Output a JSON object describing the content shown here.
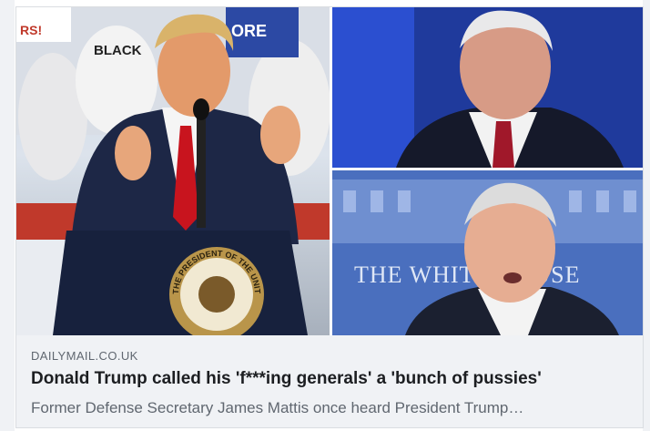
{
  "link_preview": {
    "domain": "DAILYMAIL.CO.UK",
    "headline": "Donald Trump called his 'f***ing generals' a 'bunch of pussies'",
    "description": "Former Defense Secretary James Mattis once heard President Trump…"
  },
  "images": {
    "left": {
      "signs": [
        "BLACK",
        "ORE",
        "RS!"
      ],
      "podium_seal": "THE PRESIDENT OF THE UNITED STATES"
    },
    "bottom_right": {
      "backdrop": "THE WHITE HOUSE"
    }
  }
}
